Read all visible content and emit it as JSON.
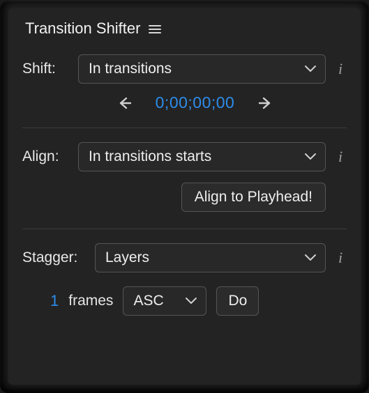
{
  "title": "Transition Shifter",
  "shift": {
    "label": "Shift:",
    "value": "In transitions",
    "timecode": "0;00;00;00"
  },
  "align": {
    "label": "Align:",
    "value": "In transitions starts",
    "button": "Align to Playhead!"
  },
  "stagger": {
    "label": "Stagger:",
    "value": "Layers",
    "frames": "1",
    "frames_label": "frames",
    "order": "ASC",
    "do": "Do"
  },
  "info_glyph": "i"
}
